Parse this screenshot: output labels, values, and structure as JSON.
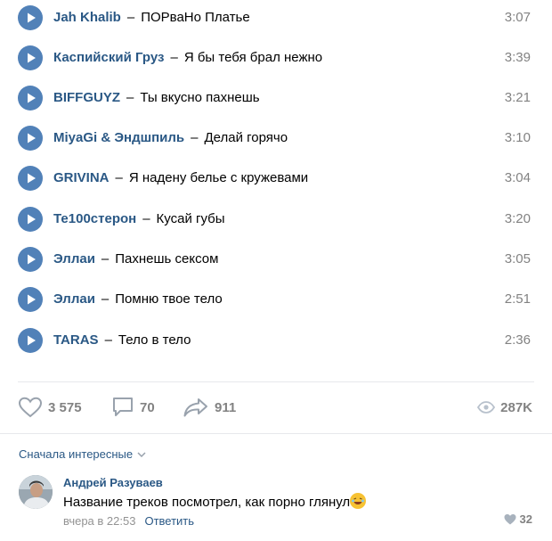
{
  "tracks": [
    {
      "artist": "Jah Khalib",
      "title": "ПОРваНо Платье",
      "duration": "3:07"
    },
    {
      "artist": "Каспийский Груз",
      "title": "Я бы тебя брал нежно",
      "duration": "3:39"
    },
    {
      "artist": "BIFFGUYZ",
      "title": "Ты вкусно пахнешь",
      "duration": "3:21"
    },
    {
      "artist": "MiyaGi & Эндшпиль",
      "title": "Делай горячо",
      "duration": "3:10"
    },
    {
      "artist": "GRIVINA",
      "title": "Я надену белье с кружевами",
      "duration": "3:04"
    },
    {
      "artist": "Те100стерон",
      "title": "Кусай губы",
      "duration": "3:20"
    },
    {
      "artist": "Эллаи",
      "title": "Пахнешь сексом",
      "duration": "3:05"
    },
    {
      "artist": "Эллаи",
      "title": "Помню твое тело",
      "duration": "2:51"
    },
    {
      "artist": "TARAS",
      "title": "Тело в тело",
      "duration": "2:36"
    }
  ],
  "separator": "–",
  "actions": {
    "likes": "3 575",
    "comments": "70",
    "shares": "911",
    "views": "287K"
  },
  "comments_section": {
    "sort_label": "Сначала интересные"
  },
  "comment": {
    "author": "Андрей Разуваев",
    "text": "Название треков посмотрел, как порно глянул",
    "time": "вчера в 22:53",
    "reply_label": "Ответить",
    "likes": "32"
  },
  "colors": {
    "accent": "#5181b8",
    "link": "#2a5885",
    "muted": "#828282"
  }
}
